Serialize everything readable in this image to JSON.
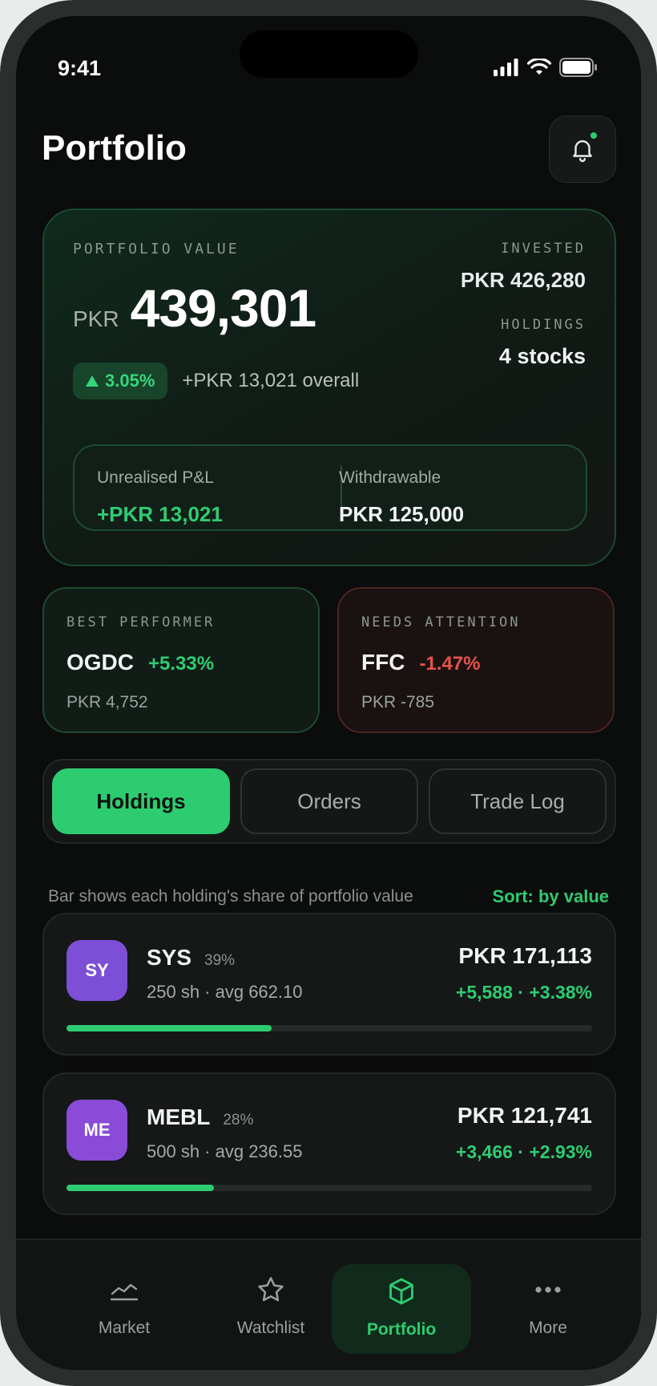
{
  "status": {
    "time": "9:41"
  },
  "header": {
    "title": "Portfolio"
  },
  "portfolio": {
    "label": "PORTFOLIO VALUE",
    "currency": "PKR",
    "amount": "439,301",
    "change_pct": "3.05%",
    "overall": "+PKR 13,021 overall",
    "invested_label": "INVESTED",
    "invested_value": "PKR 426,280",
    "holdings_label": "HOLDINGS",
    "holdings_value": "4 stocks",
    "unrealised_label": "Unrealised P&L",
    "unrealised_value": "+PKR 13,021",
    "withdrawable_label": "Withdrawable",
    "withdrawable_value": "PKR 125,000"
  },
  "best": {
    "label": "BEST PERFORMER",
    "symbol": "OGDC",
    "change": "+5.33%",
    "amount": "PKR 4,752"
  },
  "attention": {
    "label": "NEEDS ATTENTION",
    "symbol": "FFC",
    "change": "-1.47%",
    "amount": "PKR -785"
  },
  "tabs": [
    {
      "label": "Holdings",
      "active": true
    },
    {
      "label": "Orders",
      "active": false
    },
    {
      "label": "Trade Log",
      "active": false
    }
  ],
  "list_hint": "Bar shows each holding's share of portfolio value",
  "sort_label": "Sort: by value",
  "holdings": [
    {
      "initials": "SY",
      "symbol": "SYS",
      "share": "39%",
      "share_fraction": 0.39,
      "detail": "250 sh · avg 662.10",
      "value": "PKR 171,113",
      "change": "+5,588 · +3.38%",
      "avatar_color": "#7c4fd6"
    },
    {
      "initials": "ME",
      "symbol": "MEBL",
      "share": "28%",
      "share_fraction": 0.28,
      "detail": "500 sh · avg 236.55",
      "value": "PKR 121,741",
      "change": "+3,466 · +2.93%",
      "avatar_color": "#8a4bd8"
    }
  ],
  "nav": [
    {
      "label": "Market",
      "icon": "market-chart-icon"
    },
    {
      "label": "Watchlist",
      "icon": "star-icon"
    },
    {
      "label": "Portfolio",
      "icon": "cube-icon",
      "active": true
    },
    {
      "label": "More",
      "icon": "more-dots-icon"
    }
  ],
  "colors": {
    "accent": "#2ecc71",
    "negative": "#e5534b",
    "background": "#0b0c0c"
  }
}
